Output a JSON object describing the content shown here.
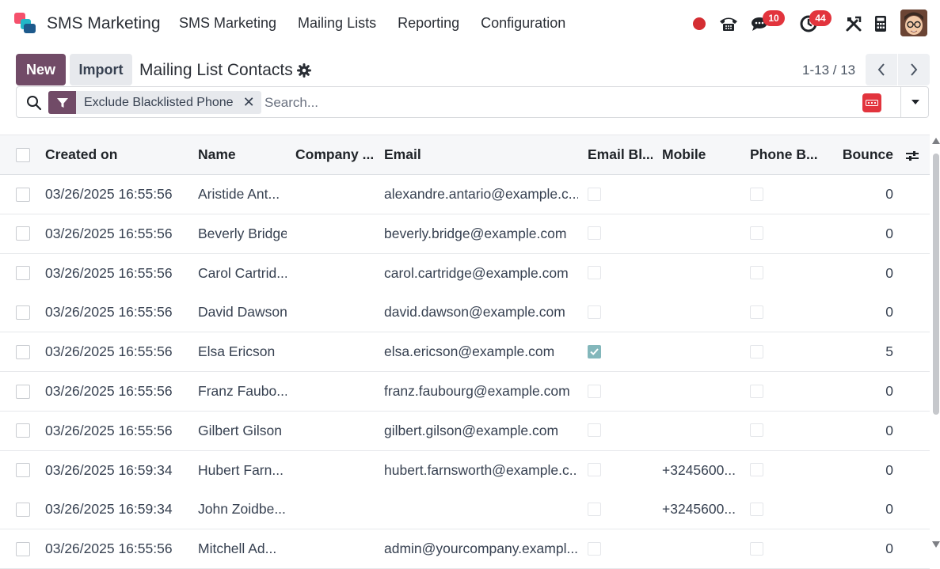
{
  "app": {
    "brand_name": "SMS Marketing",
    "menu": [
      "SMS Marketing",
      "Mailing Lists",
      "Reporting",
      "Configuration"
    ],
    "chat_badge": "10",
    "activity_badge": "44"
  },
  "control": {
    "new_label": "New",
    "import_label": "Import",
    "title": "Mailing List Contacts",
    "pager": "1-13 / 13"
  },
  "search": {
    "facet_label": "Exclude Blacklisted Phone",
    "placeholder": "Search..."
  },
  "table": {
    "headers": {
      "created_on": "Created on",
      "name": "Name",
      "company": "Company ...",
      "email": "Email",
      "email_bl": "Email Bl...",
      "mobile": "Mobile",
      "phone_bl": "Phone B...",
      "bounce": "Bounce"
    },
    "rows": [
      {
        "created_on": "03/26/2025 16:55:56",
        "name": "Aristide Ant...",
        "company": "",
        "email": "alexandre.antario@example.c...",
        "email_bl": false,
        "mobile": "",
        "phone_bl": false,
        "bounce": "0"
      },
      {
        "created_on": "03/26/2025 16:55:56",
        "name": "Beverly Bridge",
        "company": "",
        "email": "beverly.bridge@example.com",
        "email_bl": false,
        "mobile": "",
        "phone_bl": false,
        "bounce": "0"
      },
      {
        "created_on": "03/26/2025 16:55:56",
        "name": "Carol Cartrid...",
        "company": "",
        "email": "carol.cartridge@example.com",
        "email_bl": false,
        "mobile": "",
        "phone_bl": false,
        "bounce": "0"
      },
      {
        "created_on": "03/26/2025 16:55:56",
        "name": "David Dawson",
        "company": "",
        "email": "david.dawson@example.com",
        "email_bl": false,
        "mobile": "",
        "phone_bl": false,
        "bounce": "0"
      },
      {
        "created_on": "03/26/2025 16:55:56",
        "name": "Elsa Ericson",
        "company": "",
        "email": "elsa.ericson@example.com",
        "email_bl": true,
        "mobile": "",
        "phone_bl": false,
        "bounce": "5"
      },
      {
        "created_on": "03/26/2025 16:55:56",
        "name": "Franz Faubo...",
        "company": "",
        "email": "franz.faubourg@example.com",
        "email_bl": false,
        "mobile": "",
        "phone_bl": false,
        "bounce": "0"
      },
      {
        "created_on": "03/26/2025 16:55:56",
        "name": "Gilbert Gilson",
        "company": "",
        "email": "gilbert.gilson@example.com",
        "email_bl": false,
        "mobile": "",
        "phone_bl": false,
        "bounce": "0"
      },
      {
        "created_on": "03/26/2025 16:59:34",
        "name": "Hubert Farn...",
        "company": "",
        "email": "hubert.farnsworth@example.c...",
        "email_bl": false,
        "mobile": "+3245600...",
        "phone_bl": false,
        "bounce": "0"
      },
      {
        "created_on": "03/26/2025 16:59:34",
        "name": "John Zoidbe...",
        "company": "",
        "email": "",
        "email_bl": false,
        "mobile": "+3245600...",
        "phone_bl": false,
        "bounce": "0"
      },
      {
        "created_on": "03/26/2025 16:55:56",
        "name": "Mitchell Ad...",
        "company": "",
        "email": "admin@yourcompany.exampl...",
        "email_bl": false,
        "mobile": "",
        "phone_bl": false,
        "bounce": "0"
      }
    ]
  },
  "colors": {
    "primary": "#714b67",
    "badge": "#e2343d",
    "checked": "#83b7bb"
  }
}
